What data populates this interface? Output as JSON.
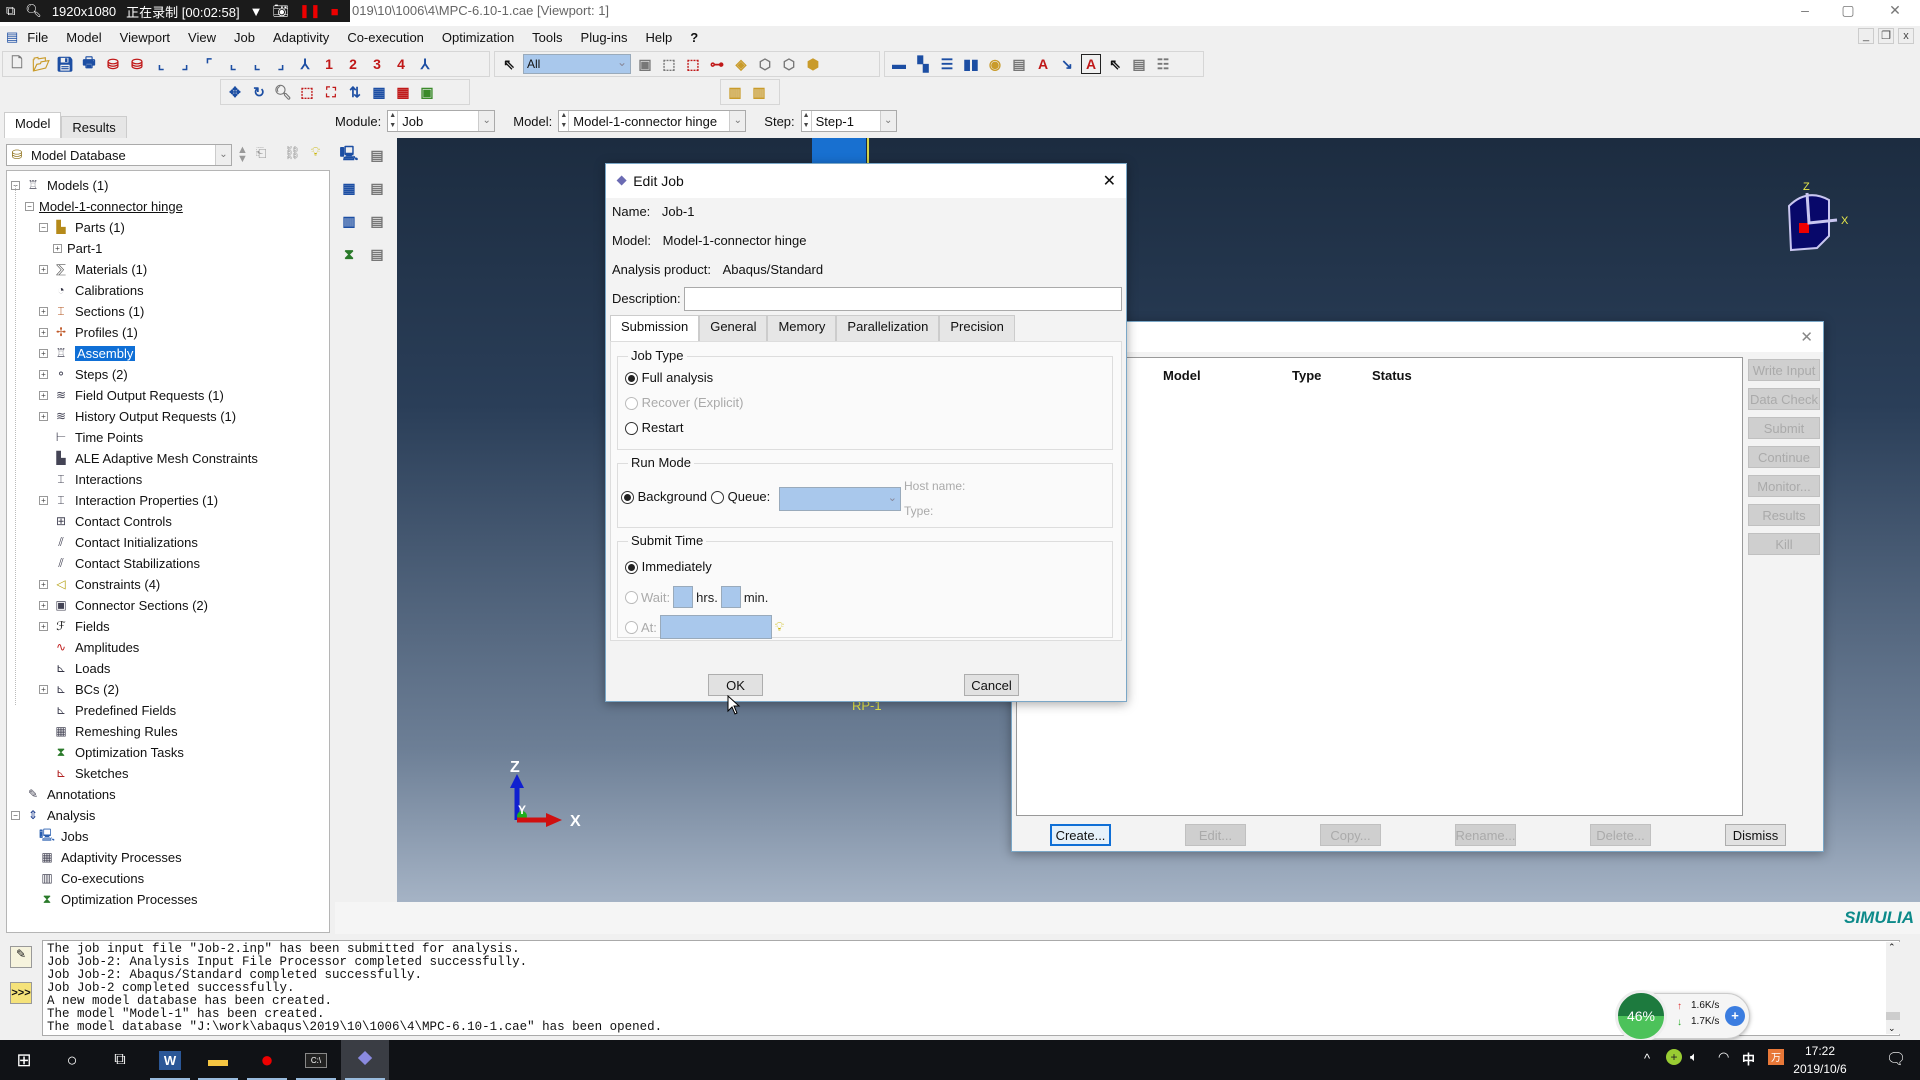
{
  "recorder": {
    "resolution": "1920x1080",
    "status": "正在录制 [00:02:58]"
  },
  "window": {
    "title_visible": "019\\10\\1006\\4\\MPC-6.10-1.cae [Viewport: 1]",
    "min": "–",
    "max": "▢",
    "close": "✕"
  },
  "menu": [
    "File",
    "Model",
    "Viewport",
    "View",
    "Job",
    "Adaptivity",
    "Co-execution",
    "Optimization",
    "Tools",
    "Plug-ins",
    "Help",
    "?"
  ],
  "toolbar": {
    "selection_filter": "All",
    "view_numbers": [
      "1",
      "2",
      "3",
      "4"
    ]
  },
  "context": {
    "module_label": "Module:",
    "module": "Job",
    "model_label": "Model:",
    "model": "Model-1-connector hinge",
    "step_label": "Step:",
    "step": "Step-1"
  },
  "left": {
    "tabs": [
      "Model",
      "Results"
    ],
    "active_tab": "Model",
    "db_select": "Model Database"
  },
  "tree": [
    {
      "label": "Models (1)",
      "level": 0,
      "exp": "-",
      "icon": "assembly-icon"
    },
    {
      "label": "Model-1-connector hinge",
      "level": 1,
      "exp": "-",
      "underline": true
    },
    {
      "label": "Parts (1)",
      "level": 2,
      "exp": "-",
      "icon": "parts-icon"
    },
    {
      "label": "Part-1",
      "level": 3,
      "exp": "+"
    },
    {
      "label": "Materials (1)",
      "level": 2,
      "exp": "+",
      "icon": "materials-icon"
    },
    {
      "label": "Calibrations",
      "level": 2,
      "icon": "calibrations-icon"
    },
    {
      "label": "Sections (1)",
      "level": 2,
      "exp": "+",
      "icon": "sections-icon"
    },
    {
      "label": "Profiles (1)",
      "level": 2,
      "exp": "+",
      "icon": "profiles-icon"
    },
    {
      "label": "Assembly",
      "level": 2,
      "exp": "+",
      "icon": "assembly-icon",
      "selected": true
    },
    {
      "label": "Steps (2)",
      "level": 2,
      "exp": "+",
      "icon": "steps-icon"
    },
    {
      "label": "Field Output Requests (1)",
      "level": 2,
      "exp": "+",
      "icon": "field-output-icon"
    },
    {
      "label": "History Output Requests (1)",
      "level": 2,
      "exp": "+",
      "icon": "history-output-icon"
    },
    {
      "label": "Time Points",
      "level": 2,
      "icon": "time-points-icon"
    },
    {
      "label": "ALE Adaptive Mesh Constraints",
      "level": 2,
      "icon": "ale-icon"
    },
    {
      "label": "Interactions",
      "level": 2,
      "icon": "interactions-icon"
    },
    {
      "label": "Interaction Properties (1)",
      "level": 2,
      "exp": "+",
      "icon": "interaction-properties-icon"
    },
    {
      "label": "Contact Controls",
      "level": 2,
      "icon": "contact-controls-icon"
    },
    {
      "label": "Contact Initializations",
      "level": 2,
      "icon": "contact-init-icon"
    },
    {
      "label": "Contact Stabilizations",
      "level": 2,
      "icon": "contact-stab-icon"
    },
    {
      "label": "Constraints (4)",
      "level": 2,
      "exp": "+",
      "icon": "constraints-icon"
    },
    {
      "label": "Connector Sections (2)",
      "level": 2,
      "exp": "+",
      "icon": "connector-sections-icon"
    },
    {
      "label": "Fields",
      "level": 2,
      "exp": "+",
      "icon": "fields-icon"
    },
    {
      "label": "Amplitudes",
      "level": 2,
      "icon": "amplitudes-icon"
    },
    {
      "label": "Loads",
      "level": 2,
      "icon": "loads-icon"
    },
    {
      "label": "BCs (2)",
      "level": 2,
      "exp": "+",
      "icon": "bcs-icon"
    },
    {
      "label": "Predefined Fields",
      "level": 2,
      "icon": "predefined-fields-icon"
    },
    {
      "label": "Remeshing Rules",
      "level": 2,
      "icon": "remeshing-icon"
    },
    {
      "label": "Optimization Tasks",
      "level": 2,
      "icon": "optimization-tasks-icon"
    },
    {
      "label": "Sketches",
      "level": 2,
      "icon": "sketches-icon"
    },
    {
      "label": "Annotations",
      "level": 0,
      "icon": "annotations-icon"
    },
    {
      "label": "Analysis",
      "level": 0,
      "exp": "-",
      "icon": "analysis-icon"
    },
    {
      "label": "Jobs",
      "level": 1,
      "icon": "jobs-icon"
    },
    {
      "label": "Adaptivity Processes",
      "level": 1,
      "icon": "adaptivity-icon"
    },
    {
      "label": "Co-executions",
      "level": 1,
      "icon": "co-executions-icon"
    },
    {
      "label": "Optimization Processes",
      "level": 1,
      "icon": "optimization-processes-icon"
    }
  ],
  "edit_job": {
    "title": "Edit Job",
    "name_label": "Name:",
    "name": "Job-1",
    "model_label": "Model:",
    "model": "Model-1-connector hinge",
    "product_label": "Analysis product:",
    "product": "Abaqus/Standard",
    "description_label": "Description:",
    "description": "",
    "tabs": [
      "Submission",
      "General",
      "Memory",
      "Parallelization",
      "Precision"
    ],
    "active_tab": "Submission",
    "job_type": {
      "title": "Job Type",
      "options": [
        "Full analysis",
        "Recover (Explicit)",
        "Restart"
      ],
      "selected": "Full analysis"
    },
    "run_mode": {
      "title": "Run Mode",
      "background": "Background",
      "queue": "Queue:",
      "host_name": "Host name:",
      "type": "Type:",
      "selected": "Background"
    },
    "submit_time": {
      "title": "Submit Time",
      "immediately": "Immediately",
      "wait": "Wait:",
      "hrs": "hrs.",
      "min": "min.",
      "at": "At:",
      "selected": "Immediately"
    },
    "ok": "OK",
    "cancel": "Cancel"
  },
  "job_manager": {
    "columns": [
      "Model",
      "Type",
      "Status"
    ],
    "side_buttons": [
      "Write Input",
      "Data Check",
      "Submit",
      "Continue",
      "Monitor...",
      "Results",
      "Kill"
    ],
    "bottom_buttons": [
      "Create...",
      "Edit...",
      "Copy...",
      "Rename...",
      "Delete...",
      "Dismiss"
    ]
  },
  "viewport": {
    "triad_labels": [
      "Z",
      "Y",
      "X"
    ],
    "rp_label": "RP-1",
    "brand": "SIMULIA"
  },
  "messages": [
    "The job input file \"Job-2.inp\" has been submitted for analysis.",
    "Job Job-2: Analysis Input File Processor completed successfully.",
    "Job Job-2: Abaqus/Standard completed successfully.",
    "Job Job-2 completed successfully.",
    "A new model database has been created.",
    "The model \"Model-1\" has been created.",
    "The model database \"J:\\work\\abaqus\\2019\\10\\1006\\4\\MPC-6.10-1.cae\" has been opened."
  ],
  "net_widget": {
    "percent": "46%",
    "up": "1.6K/s",
    "down": "1.7K/s"
  },
  "tray": {
    "ime": "中",
    "time": "17:22",
    "date": "2019/10/6"
  }
}
